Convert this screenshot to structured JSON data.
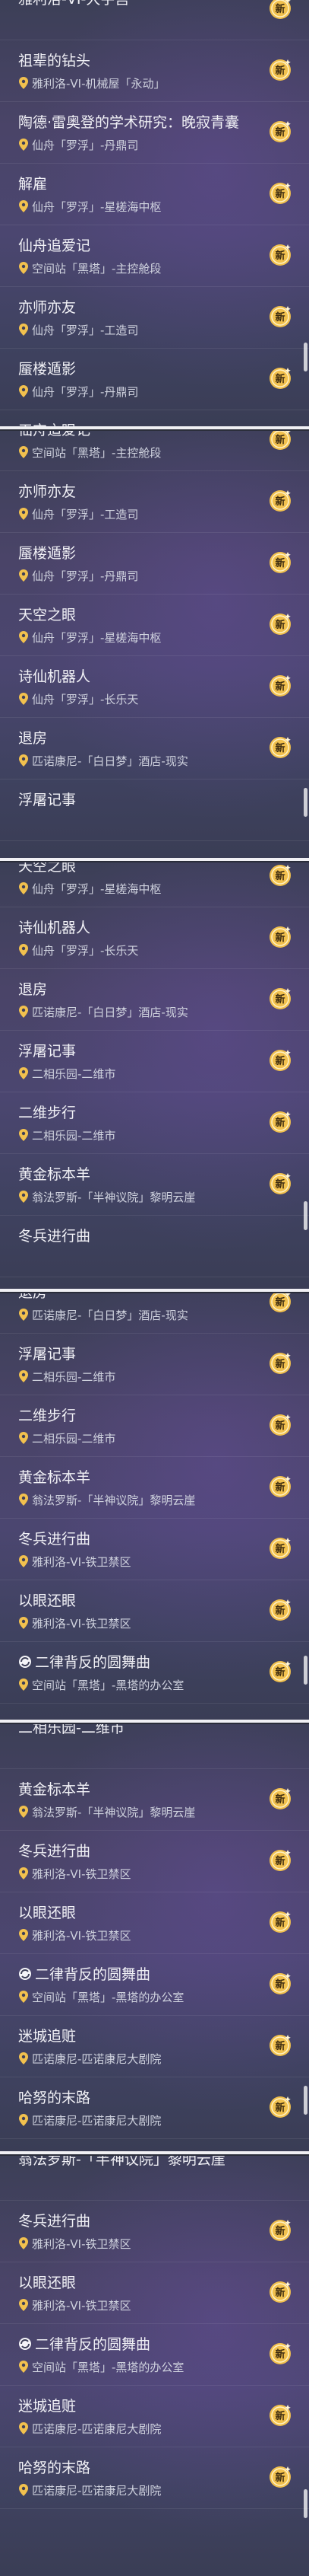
{
  "panels": [
    {
      "items": [
        {
          "title": "雅利洛-VI-大宇宫",
          "sub": "",
          "badge": "new"
        },
        {
          "title": "祖辈的钻头",
          "sub": "雅利洛-VI-机械屋「永动」",
          "badge": "new"
        },
        {
          "title": "陶德·雷奥登的学术研究：晚寂青囊",
          "sub": "仙舟「罗浮」-丹鼎司",
          "badge": "new"
        },
        {
          "title": "解雇",
          "sub": "仙舟「罗浮」-星槎海中枢",
          "badge": "new"
        },
        {
          "title": "仙舟追爱记",
          "sub": "空间站「黑塔」-主控舱段",
          "badge": "new"
        },
        {
          "title": "亦师亦友",
          "sub": "仙舟「罗浮」-工造司",
          "badge": "new"
        },
        {
          "title": "蜃楼遁影",
          "sub": "仙舟「罗浮」-丹鼎司",
          "badge": "new"
        },
        {
          "title": "天空之眼",
          "sub": "仙舟「罗浮」-星槎海中枢",
          "badge": "none"
        }
      ]
    },
    {
      "items": [
        {
          "title": "仙舟追爱记",
          "sub": "空间站「黑塔」-主控舱段",
          "badge": "new"
        },
        {
          "title": "亦师亦友",
          "sub": "仙舟「罗浮」-工造司",
          "badge": "new"
        },
        {
          "title": "蜃楼遁影",
          "sub": "仙舟「罗浮」-丹鼎司",
          "badge": "new"
        },
        {
          "title": "天空之眼",
          "sub": "仙舟「罗浮」-星槎海中枢",
          "badge": "new"
        },
        {
          "title": "诗仙机器人",
          "sub": "仙舟「罗浮」-长乐天",
          "badge": "new"
        },
        {
          "title": "退房",
          "sub": "匹诺康尼-「白日梦」酒店-现实",
          "badge": "new"
        },
        {
          "title": "浮屠记事",
          "sub": "",
          "badge": "none"
        }
      ]
    },
    {
      "items": [
        {
          "title": "天空之眼",
          "sub": "仙舟「罗浮」-星槎海中枢",
          "badge": "new"
        },
        {
          "title": "诗仙机器人",
          "sub": "仙舟「罗浮」-长乐天",
          "badge": "new"
        },
        {
          "title": "退房",
          "sub": "匹诺康尼-「白日梦」酒店-现实",
          "badge": "new"
        },
        {
          "title": "浮屠记事",
          "sub": "二相乐园-二维市",
          "badge": "new"
        },
        {
          "title": "二维步行",
          "sub": "二相乐园-二维市",
          "badge": "new"
        },
        {
          "title": "黄金标本羊",
          "sub": "翁法罗斯-「半神议院」黎明云崖",
          "badge": "new"
        },
        {
          "title": "冬兵进行曲",
          "sub": "",
          "badge": "none"
        }
      ]
    },
    {
      "items": [
        {
          "title": "退房",
          "sub": "匹诺康尼-「白日梦」酒店-现实",
          "badge": "new"
        },
        {
          "title": "浮屠记事",
          "sub": "二相乐园-二维市",
          "badge": "new"
        },
        {
          "title": "二维步行",
          "sub": "二相乐园-二维市",
          "badge": "new"
        },
        {
          "title": "黄金标本羊",
          "sub": "翁法罗斯-「半神议院」黎明云崖",
          "badge": "new"
        },
        {
          "title": "冬兵进行曲",
          "sub": "雅利洛-VI-铁卫禁区",
          "badge": "new"
        },
        {
          "title": "以眼还眼",
          "sub": "雅利洛-VI-铁卫禁区",
          "badge": "new"
        },
        {
          "title": "二律背反的圆舞曲",
          "sub": "空间站「黑塔」-黑塔的办公室",
          "badge": "new",
          "swirl": true
        }
      ]
    },
    {
      "items": [
        {
          "title": "二相乐园-二维市",
          "sub": "",
          "badge": "none"
        },
        {
          "title": "黄金标本羊",
          "sub": "翁法罗斯-「半神议院」黎明云崖",
          "badge": "new"
        },
        {
          "title": "冬兵进行曲",
          "sub": "雅利洛-VI-铁卫禁区",
          "badge": "new"
        },
        {
          "title": "以眼还眼",
          "sub": "雅利洛-VI-铁卫禁区",
          "badge": "new"
        },
        {
          "title": "二律背反的圆舞曲",
          "sub": "空间站「黑塔」-黑塔的办公室",
          "badge": "new",
          "swirl": true
        },
        {
          "title": "迷城追赃",
          "sub": "匹诺康尼-匹诺康尼大剧院",
          "badge": "new"
        },
        {
          "title": "哈努的末路",
          "sub": "匹诺康尼-匹诺康尼大剧院",
          "badge": "new"
        }
      ]
    },
    {
      "items": [
        {
          "title": "翁法罗斯-「半神议院」黎明云崖",
          "sub": "",
          "badge": "none"
        },
        {
          "title": "冬兵进行曲",
          "sub": "雅利洛-VI-铁卫禁区",
          "badge": "new"
        },
        {
          "title": "以眼还眼",
          "sub": "雅利洛-VI-铁卫禁区",
          "badge": "new"
        },
        {
          "title": "二律背反的圆舞曲",
          "sub": "空间站「黑塔」-黑塔的办公室",
          "badge": "new",
          "swirl": true
        },
        {
          "title": "迷城追赃",
          "sub": "匹诺康尼-匹诺康尼大剧院",
          "badge": "new"
        },
        {
          "title": "哈努的末路",
          "sub": "匹诺康尼-匹诺康尼大剧院",
          "badge": "new"
        }
      ]
    }
  ],
  "badge_label": "新",
  "colors": {
    "badge_bg": "#f2c14e",
    "badge_fg": "#3a2a10",
    "pin": "#f2c14e"
  }
}
